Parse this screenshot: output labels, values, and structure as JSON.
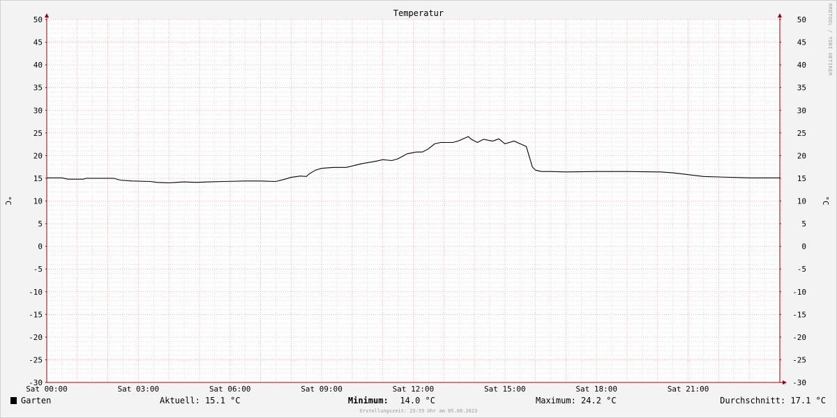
{
  "chart_data": {
    "type": "line",
    "title": "Temperatur",
    "ylabel": "°C",
    "ylim": [
      -30,
      50
    ],
    "yticks": [
      -30,
      -25,
      -20,
      -15,
      -10,
      -5,
      0,
      5,
      10,
      15,
      20,
      25,
      30,
      35,
      40,
      45,
      50
    ],
    "xlim": [
      0,
      24
    ],
    "xtick_values": [
      0,
      3,
      6,
      9,
      12,
      15,
      18,
      21
    ],
    "xtick_labels": [
      "Sat 00:00",
      "Sat 03:00",
      "Sat 06:00",
      "Sat 09:00",
      "Sat 12:00",
      "Sat 15:00",
      "Sat 18:00",
      "Sat 21:00"
    ],
    "grid": true,
    "x_unit": "hours",
    "series": [
      {
        "name": "Garten",
        "color": "#000000",
        "x": [
          0,
          0.5,
          0.7,
          1.2,
          1.3,
          2.2,
          2.4,
          2.8,
          3.4,
          3.6,
          4.0,
          4.5,
          4.9,
          5.3,
          5.8,
          6.5,
          7.0,
          7.5,
          7.8,
          8.0,
          8.3,
          8.5,
          8.6,
          8.8,
          9.0,
          9.4,
          9.8,
          10.3,
          10.8,
          11.0,
          11.3,
          11.5,
          11.8,
          12.1,
          12.3,
          12.5,
          12.7,
          12.9,
          13.3,
          13.5,
          13.8,
          13.9,
          14.1,
          14.3,
          14.6,
          14.8,
          15.0,
          15.3,
          15.5,
          15.7,
          15.9,
          16.0,
          16.2,
          16.5,
          17.0,
          18.0,
          19.0,
          20.0,
          20.1,
          20.5,
          21.0,
          21.5,
          22.0,
          23.0,
          24.0
        ],
        "values": [
          15.1,
          15.1,
          14.8,
          14.8,
          15.0,
          15.0,
          14.6,
          14.4,
          14.3,
          14.1,
          14.0,
          14.2,
          14.1,
          14.2,
          14.3,
          14.4,
          14.4,
          14.3,
          14.8,
          15.2,
          15.5,
          15.4,
          16.0,
          16.8,
          17.2,
          17.4,
          17.4,
          18.2,
          18.8,
          19.1,
          18.9,
          19.3,
          20.4,
          20.8,
          20.8,
          21.5,
          22.6,
          22.9,
          22.9,
          23.3,
          24.2,
          23.6,
          22.9,
          23.6,
          23.2,
          23.7,
          22.6,
          23.2,
          22.6,
          22.0,
          17.5,
          16.8,
          16.5,
          16.5,
          16.4,
          16.5,
          16.5,
          16.4,
          16.4,
          16.2,
          15.8,
          15.4,
          15.3,
          15.1,
          15.1
        ]
      }
    ]
  },
  "watermark": "RRDTOOL / TOBI OETIKER",
  "legend": {
    "series_name": "Garten",
    "current": "Aktuell: 15.1 °C",
    "minimum_label": "Minimum:",
    "minimum_value": "14.0 °C",
    "maximum": "Maximum: 24.2 °C",
    "average": "Durchschnitt: 17.1 °C"
  },
  "footer": "Erstellungszeit: 23:55 Uhr am 05.08.2023",
  "colors": {
    "major_grid": "#e8a0a0",
    "minor_grid": "#c8c8c8",
    "axis": "#a00000",
    "plot_bg": "#ffffff",
    "line": "#000000"
  }
}
